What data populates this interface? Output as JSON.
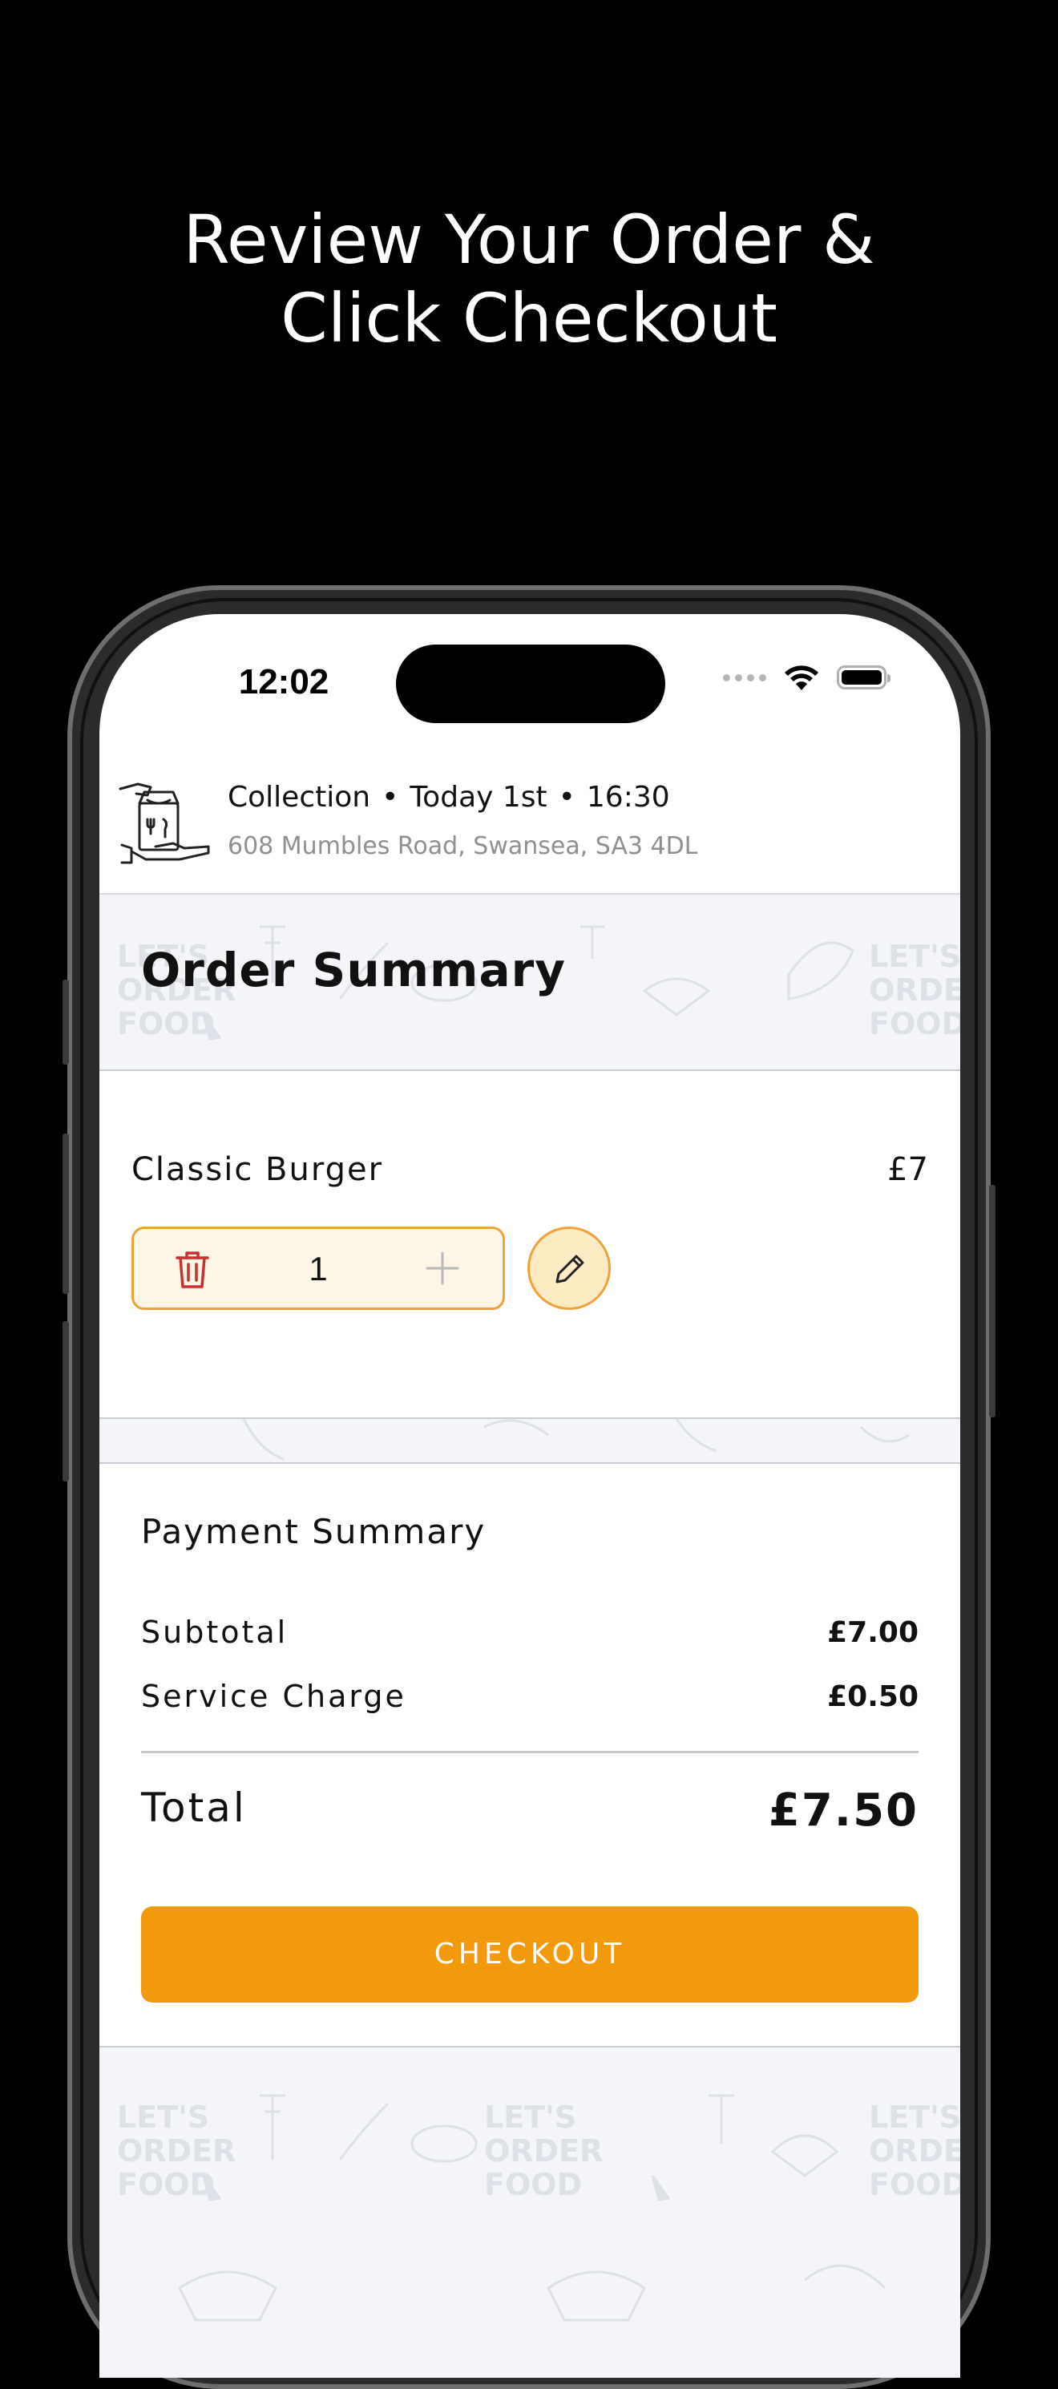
{
  "promo": {
    "line1": "Review Your Order &",
    "line2": "Click Checkout"
  },
  "status_bar": {
    "time": "12:02",
    "icons": [
      "signal-dots-icon",
      "wifi-icon",
      "battery-icon"
    ]
  },
  "order_header": {
    "icon": "collection-bag-icon",
    "mode": "Collection",
    "separator": "•",
    "day": "Today 1st",
    "time": "16:30",
    "address": "608 Mumbles Road, Swansea, SA3  4DL"
  },
  "pattern_text": [
    "LET'S",
    "ORDER",
    "FOOD"
  ],
  "order_summary": {
    "title": "Order Summary"
  },
  "items": [
    {
      "name": "Classic Burger",
      "price": "£7",
      "quantity": "1"
    }
  ],
  "payment_summary": {
    "title": "Payment Summary",
    "rows": [
      {
        "label": "Subtotal",
        "value": "£7.00"
      },
      {
        "label": "Service Charge",
        "value": "£0.50"
      }
    ],
    "total_label": "Total",
    "total_value": "£7.50",
    "checkout_label": "CHECKOUT"
  },
  "colors": {
    "accent": "#f29a0b",
    "accent_border": "#f0a23a",
    "qty_bg": "#fdf5e6",
    "trash": "#c8302e",
    "pattern_bg": "#f4f5f9"
  }
}
